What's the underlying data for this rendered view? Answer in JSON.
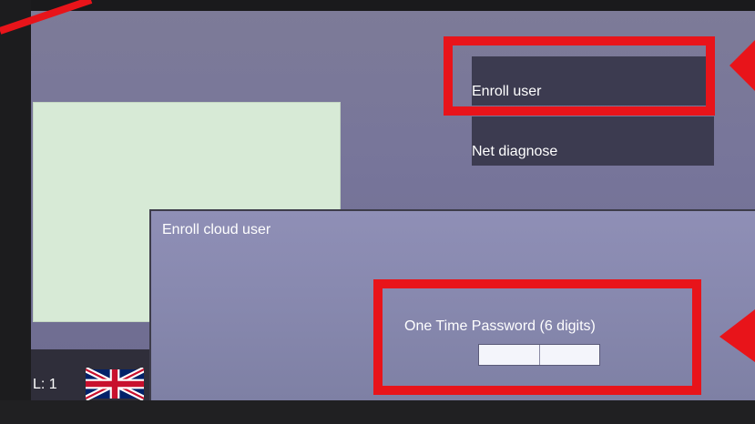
{
  "main": {
    "buttons": {
      "enroll_user": "Enroll user",
      "net_diagnose": "Net diagnose"
    }
  },
  "status": {
    "level": "L: 1",
    "language_flag": "uk-flag-icon"
  },
  "dialog": {
    "title": "Enroll cloud user",
    "otp_label": "One Time Password (6 digits)",
    "otp_value": ""
  },
  "annotations": {
    "highlight_color": "#e8141a"
  },
  "colors": {
    "screen_bg": "#77759a",
    "button_bg": "#3c3b50",
    "dialog_bg": "#8788ae",
    "preview_bg": "#d7ead6"
  }
}
